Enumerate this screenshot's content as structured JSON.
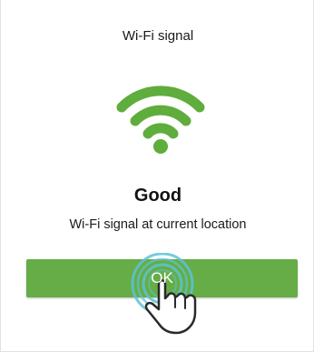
{
  "dialog": {
    "title": "Wi-Fi signal",
    "status": "Good",
    "description": "Wi-Fi signal at current location",
    "ok_label": "OK"
  },
  "icons": {
    "wifi": "wifi-signal-icon",
    "hand": "tap-hand-icon"
  },
  "colors": {
    "accent": "#66ad47",
    "wifi": "#5fad3c",
    "tap_ring": "#5bc3d6"
  }
}
